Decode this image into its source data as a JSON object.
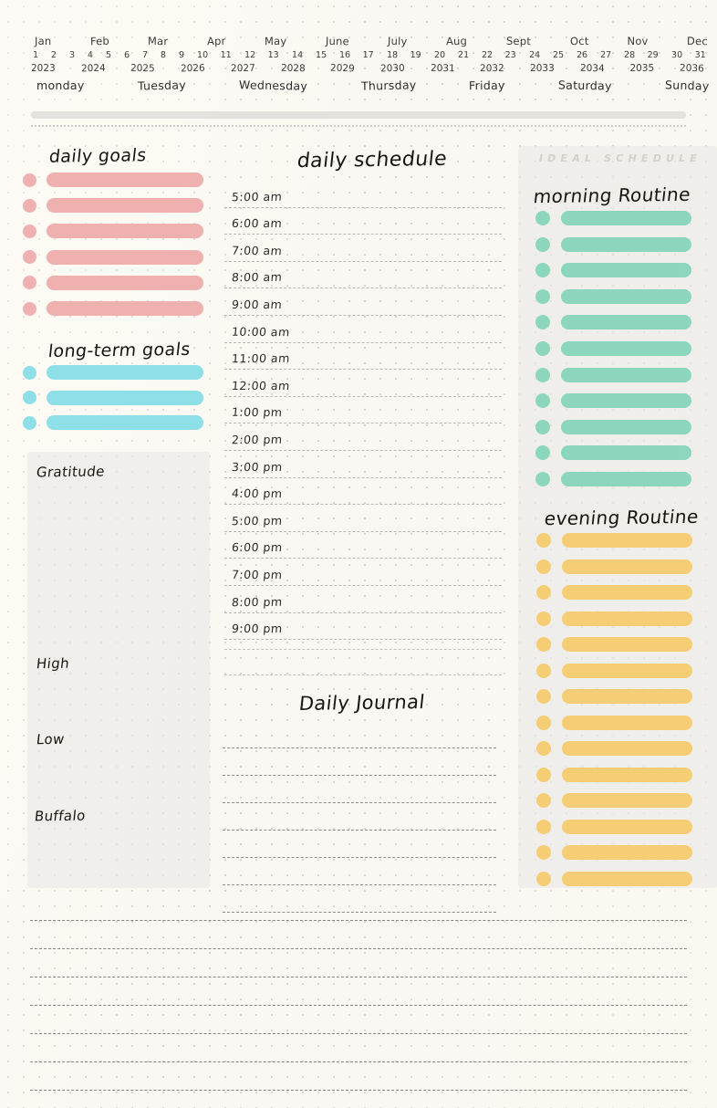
{
  "header": {
    "months": [
      "Jan",
      "Feb",
      "Mar",
      "Apr",
      "May",
      "June",
      "July",
      "Aug",
      "Sept",
      "Oct",
      "Nov",
      "Dec"
    ],
    "days": [
      "1",
      "2",
      "3",
      "4",
      "5",
      "6",
      "7",
      "8",
      "9",
      "10",
      "11",
      "12",
      "13",
      "14",
      "15",
      "16",
      "17",
      "18",
      "19",
      "20",
      "21",
      "22",
      "23",
      "24",
      "25",
      "26",
      "27",
      "28",
      "29",
      "30",
      "31"
    ],
    "years": [
      "2023",
      "2024",
      "2025",
      "2026",
      "2027",
      "2028",
      "2029",
      "2030",
      "2031",
      "2032",
      "2033",
      "2034",
      "2035",
      "2036"
    ],
    "weekdays": [
      "monday",
      "Tuesday",
      "Wednesday",
      "Thursday",
      "Friday",
      "Saturday",
      "Sunday"
    ]
  },
  "daily_goals": {
    "title": "daily goals",
    "rows": [
      1,
      2,
      3,
      4,
      5,
      6
    ],
    "color": "#efb0b0"
  },
  "long_term_goals": {
    "title": "long-term goals",
    "rows": [
      1,
      2,
      3
    ],
    "color": "#8edfe8"
  },
  "gratitude_panel": {
    "gratitude_label": "Gratitude",
    "high_label": "High",
    "low_label": "Low",
    "buffalo_label": "Buffalo"
  },
  "daily_schedule": {
    "title": "daily schedule",
    "times": [
      "5:00 am",
      "6:00 am",
      "7:00 am",
      "8:00 am",
      "9:00 am",
      "10:00 am",
      "11:00 am",
      "12:00 am",
      "1:00 pm",
      "2:00 pm",
      "3:00 pm",
      "4:00 pm",
      "5:00 pm",
      "6:00 pm",
      "7:00 pm",
      "8:00 pm",
      "9:00 pm"
    ],
    "blank_rows": [
      1,
      2
    ]
  },
  "daily_journal": {
    "title": "Daily Journal",
    "lines": [
      1,
      2,
      3,
      4,
      5,
      6,
      7
    ]
  },
  "ideal_schedule": {
    "label": "IDEAL SCHEDULE",
    "morning": {
      "title": "morning Routine",
      "rows": [
        1,
        2,
        3,
        4,
        5,
        6,
        7,
        8,
        9,
        10,
        11
      ],
      "color": "#8cd6bd"
    },
    "evening": {
      "title": "evening Routine",
      "rows": [
        1,
        2,
        3,
        4,
        5,
        6,
        7,
        8,
        9,
        10,
        11,
        12,
        13,
        14
      ],
      "color": "#f5cd74"
    }
  },
  "bottom_notes": {
    "lines": [
      1,
      2,
      3,
      4,
      5,
      6,
      7
    ]
  },
  "theme": {
    "paper": "#faf8f2",
    "panel": "#e8e8e6",
    "ink": "#1d1c1b"
  }
}
